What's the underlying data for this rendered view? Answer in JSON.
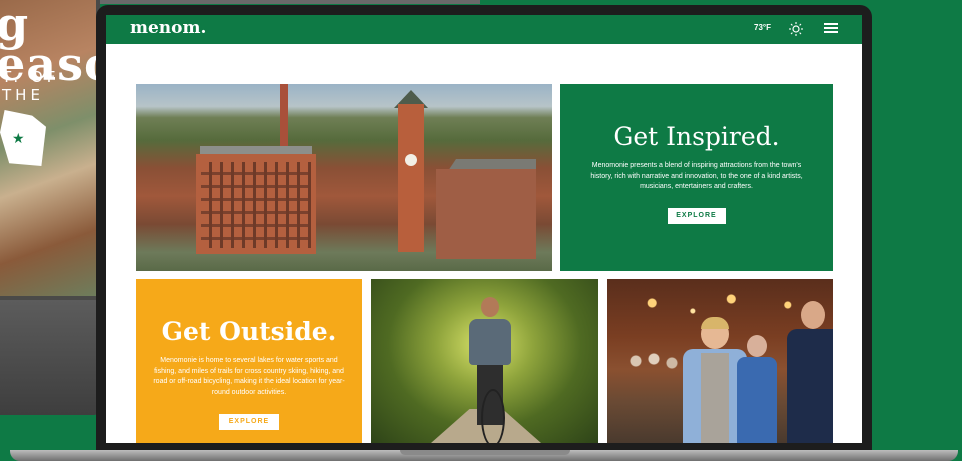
{
  "background": {
    "promo_title": "g\neaso",
    "promo_subtitle": "T. OF THE",
    "colors": {
      "brand_green": "#0e7a45",
      "brand_gold": "#f6a919"
    }
  },
  "nav": {
    "logo": "menom.",
    "temperature": "73°F",
    "weather_icon": "sun-icon",
    "menu_icon": "hamburger-menu-icon"
  },
  "tiles": {
    "inspired": {
      "title": "Get Inspired.",
      "body": "Menomonie presents a blend of inspiring attractions from the town's history, rich with narrative and innovation, to the one of a kind artists, musicians, entertainers and crafters.",
      "button": "EXPLORE"
    },
    "outside": {
      "title": "Get Outside.",
      "body": "Menomonie is home to several lakes for water sports and fishing, and miles of trails for cross country skiing, hiking, and road or off-road bicycling, making it the ideal location for year-round outdoor activities.",
      "button": "EXPLORE"
    }
  }
}
